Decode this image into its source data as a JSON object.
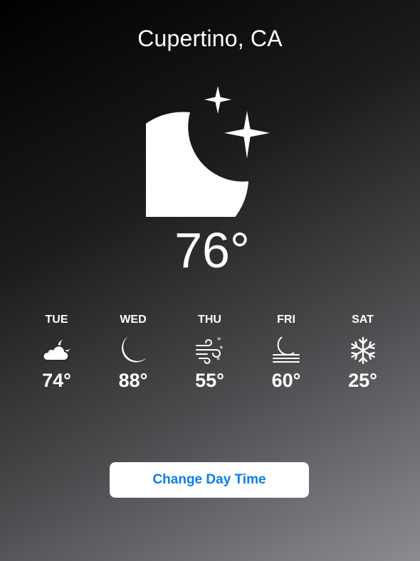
{
  "location": {
    "city": "Cupertino, CA"
  },
  "current": {
    "icon": "moon-stars-icon",
    "temperature": "76°"
  },
  "forecast": [
    {
      "day": "TUE",
      "icon": "cloud-moon-icon",
      "temperature": "74°"
    },
    {
      "day": "WED",
      "icon": "moon-icon",
      "temperature": "88°"
    },
    {
      "day": "THU",
      "icon": "wind-snow-icon",
      "temperature": "55°"
    },
    {
      "day": "FRI",
      "icon": "moon-haze-icon",
      "temperature": "60°"
    },
    {
      "day": "SAT",
      "icon": "snowflake-icon",
      "temperature": "25°"
    }
  ],
  "action": {
    "label": "Change Day Time"
  },
  "colors": {
    "background_top": "#000000",
    "background_bottom": "#8c8b91",
    "text": "#ffffff",
    "button_bg": "#ffffff",
    "button_text": "#0a7ee6"
  }
}
